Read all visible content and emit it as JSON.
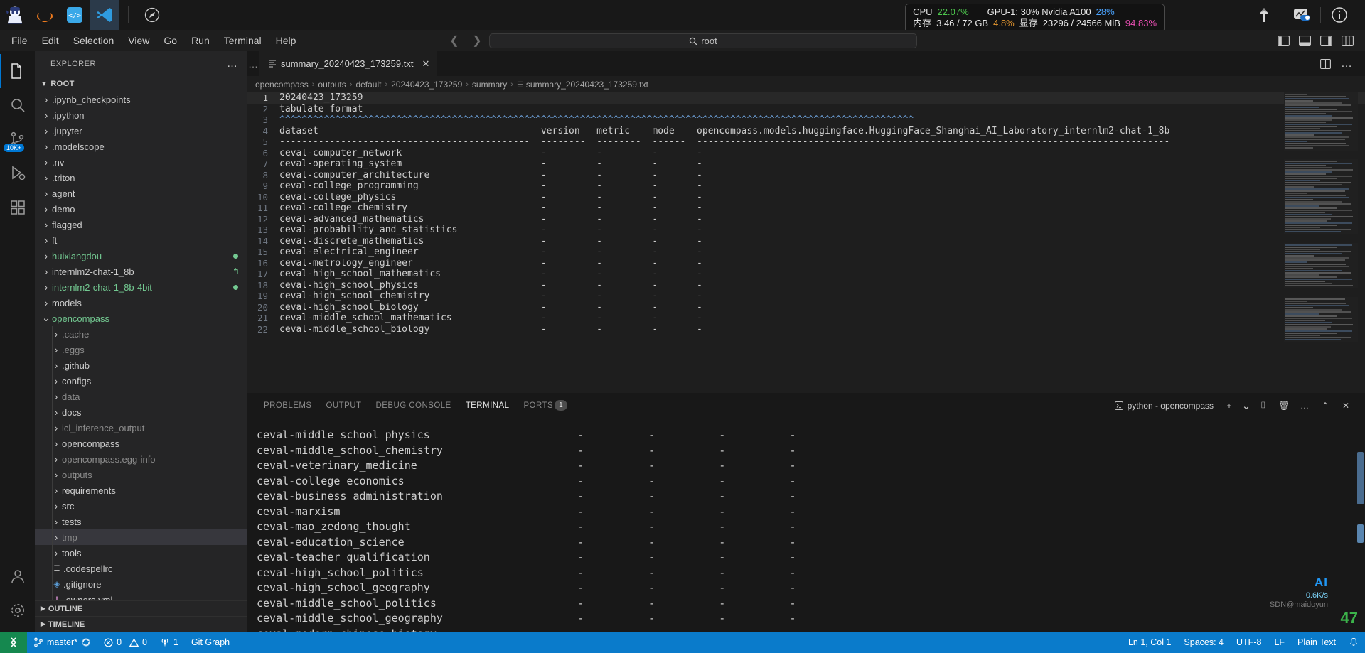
{
  "window": {
    "app_icons": [
      "penguin-app-icon",
      "moon-app-icon",
      "code-server-icon",
      "vscode-icon",
      "compass-icon"
    ]
  },
  "system_monitor": {
    "cpu_label": "CPU",
    "cpu_value": "22.07%",
    "gpu_label": "GPU-1: 30% Nvidia A100",
    "gpu_value": "28%",
    "mem_label": "内存",
    "mem_value": "3.46 / 72 GB",
    "mem_pct": "4.8%",
    "vram_label": "显存",
    "vram_value": "23296 / 24566 MiB",
    "vram_pct": "94.83%"
  },
  "menubar": {
    "items": [
      "File",
      "Edit",
      "Selection",
      "View",
      "Go",
      "Run",
      "Terminal",
      "Help"
    ]
  },
  "command_center": {
    "icon": "search-icon",
    "value": "root"
  },
  "activity_bar": {
    "items": [
      {
        "name": "explorer",
        "icon": "files-icon",
        "badge": ""
      },
      {
        "name": "search",
        "icon": "search-icon",
        "badge": ""
      },
      {
        "name": "source-control",
        "icon": "source-control-icon",
        "badge": "10K+"
      },
      {
        "name": "run-debug",
        "icon": "run-debug-icon",
        "badge": ""
      },
      {
        "name": "extensions",
        "icon": "extensions-icon",
        "badge": ""
      }
    ],
    "bottom_items": [
      {
        "name": "accounts",
        "icon": "account-icon"
      },
      {
        "name": "manage",
        "icon": "gear-icon"
      }
    ]
  },
  "sidebar": {
    "title": "EXPLORER",
    "more_actions": "…",
    "root_label": "ROOT",
    "items": [
      {
        "label": ".ipynb_checkpoints",
        "type": "folder",
        "indent": 1,
        "state": "collapsed",
        "style": "normal",
        "badge": ""
      },
      {
        "label": ".ipython",
        "type": "folder",
        "indent": 1,
        "state": "collapsed",
        "style": "normal",
        "badge": ""
      },
      {
        "label": ".jupyter",
        "type": "folder",
        "indent": 1,
        "state": "collapsed",
        "style": "normal",
        "badge": ""
      },
      {
        "label": ".modelscope",
        "type": "folder",
        "indent": 1,
        "state": "collapsed",
        "style": "normal",
        "badge": ""
      },
      {
        "label": ".nv",
        "type": "folder",
        "indent": 1,
        "state": "collapsed",
        "style": "normal",
        "badge": ""
      },
      {
        "label": ".triton",
        "type": "folder",
        "indent": 1,
        "state": "collapsed",
        "style": "normal",
        "badge": ""
      },
      {
        "label": "agent",
        "type": "folder",
        "indent": 1,
        "state": "collapsed",
        "style": "normal",
        "badge": ""
      },
      {
        "label": "demo",
        "type": "folder",
        "indent": 1,
        "state": "collapsed",
        "style": "normal",
        "badge": ""
      },
      {
        "label": "flagged",
        "type": "folder",
        "indent": 1,
        "state": "collapsed",
        "style": "normal",
        "badge": ""
      },
      {
        "label": "ft",
        "type": "folder",
        "indent": 1,
        "state": "collapsed",
        "style": "normal",
        "badge": ""
      },
      {
        "label": "huixiangdou",
        "type": "folder",
        "indent": 1,
        "state": "collapsed",
        "style": "modified",
        "badge": "dot"
      },
      {
        "label": "internlm2-chat-1_8b",
        "type": "folder",
        "indent": 1,
        "state": "collapsed",
        "style": "normal",
        "badge": "link"
      },
      {
        "label": "internlm2-chat-1_8b-4bit",
        "type": "folder",
        "indent": 1,
        "state": "collapsed",
        "style": "modified",
        "badge": "dot"
      },
      {
        "label": "models",
        "type": "folder",
        "indent": 1,
        "state": "collapsed",
        "style": "normal",
        "badge": ""
      },
      {
        "label": "opencompass",
        "type": "folder",
        "indent": 1,
        "state": "expanded",
        "style": "modified",
        "badge": ""
      },
      {
        "label": ".cache",
        "type": "folder",
        "indent": 2,
        "state": "collapsed",
        "style": "dim",
        "badge": ""
      },
      {
        "label": ".eggs",
        "type": "folder",
        "indent": 2,
        "state": "collapsed",
        "style": "dim",
        "badge": ""
      },
      {
        "label": ".github",
        "type": "folder",
        "indent": 2,
        "state": "collapsed",
        "style": "normal",
        "badge": ""
      },
      {
        "label": "configs",
        "type": "folder",
        "indent": 2,
        "state": "collapsed",
        "style": "normal",
        "badge": ""
      },
      {
        "label": "data",
        "type": "folder",
        "indent": 2,
        "state": "collapsed",
        "style": "dim",
        "badge": ""
      },
      {
        "label": "docs",
        "type": "folder",
        "indent": 2,
        "state": "collapsed",
        "style": "normal",
        "badge": ""
      },
      {
        "label": "icl_inference_output",
        "type": "folder",
        "indent": 2,
        "state": "collapsed",
        "style": "dim",
        "badge": ""
      },
      {
        "label": "opencompass",
        "type": "folder",
        "indent": 2,
        "state": "collapsed",
        "style": "normal",
        "badge": ""
      },
      {
        "label": "opencompass.egg-info",
        "type": "folder",
        "indent": 2,
        "state": "collapsed",
        "style": "dim",
        "badge": ""
      },
      {
        "label": "outputs",
        "type": "folder",
        "indent": 2,
        "state": "collapsed",
        "style": "dim",
        "badge": ""
      },
      {
        "label": "requirements",
        "type": "folder",
        "indent": 2,
        "state": "collapsed",
        "style": "normal",
        "badge": ""
      },
      {
        "label": "src",
        "type": "folder",
        "indent": 2,
        "state": "collapsed",
        "style": "normal",
        "badge": ""
      },
      {
        "label": "tests",
        "type": "folder",
        "indent": 2,
        "state": "collapsed",
        "style": "normal",
        "badge": ""
      },
      {
        "label": "tmp",
        "type": "folder",
        "indent": 2,
        "state": "collapsed",
        "style": "dim",
        "badge": "",
        "selected": true
      },
      {
        "label": "tools",
        "type": "folder",
        "indent": 2,
        "state": "collapsed",
        "style": "normal",
        "badge": ""
      },
      {
        "label": ".codespellrc",
        "type": "file",
        "indent": 2,
        "state": "",
        "style": "normal",
        "badge": "",
        "fileicon": "text-file-icon"
      },
      {
        "label": ".gitignore",
        "type": "file",
        "indent": 2,
        "state": "",
        "style": "normal",
        "badge": "",
        "fileicon": "git-file-icon"
      },
      {
        "label": ".owners.yml",
        "type": "file",
        "indent": 2,
        "state": "",
        "style": "normal",
        "badge": "",
        "fileicon": "yaml-file-icon"
      }
    ],
    "outline_label": "OUTLINE",
    "timeline_label": "TIMELINE"
  },
  "editor": {
    "tab": {
      "icon": "text-file-icon",
      "label": "summary_20240423_173259.txt",
      "close": "✕"
    },
    "tab_actions": [
      "split-editor-icon",
      "more-actions-icon"
    ],
    "breadcrumb": [
      "opencompass",
      "outputs",
      "default",
      "20240423_173259",
      "summary",
      "summary_20240423_173259.txt"
    ],
    "lines": [
      {
        "n": 1,
        "text": "20240423_173259"
      },
      {
        "n": 2,
        "text": "tabulate format"
      },
      {
        "n": 3,
        "text": "^^^^^^^^^^^^^^^^^^^^^^^^^^^^^^^^^^^^^^^^^^^^^^^^^^^^^^^^^^^^^^^^^^^^^^^^^^^^^^^^^^^^^^^^^^^^^^^^^^^^^^^^^^^^^^^^^^"
      },
      {
        "n": 4,
        "text": "dataset                                        version   metric    mode    opencompass.models.huggingface.HuggingFace_Shanghai_AI_Laboratory_internlm2-chat-1_8b"
      },
      {
        "n": 5,
        "text": "---------------------------------------------  --------  --------  ------  -------------------------------------------------------------------------------------"
      },
      {
        "n": 6,
        "text": "ceval-computer_network                         -         -         -       -"
      },
      {
        "n": 7,
        "text": "ceval-operating_system                         -         -         -       -"
      },
      {
        "n": 8,
        "text": "ceval-computer_architecture                    -         -         -       -"
      },
      {
        "n": 9,
        "text": "ceval-college_programming                      -         -         -       -"
      },
      {
        "n": 10,
        "text": "ceval-college_physics                          -         -         -       -"
      },
      {
        "n": 11,
        "text": "ceval-college_chemistry                        -         -         -       -"
      },
      {
        "n": 12,
        "text": "ceval-advanced_mathematics                     -         -         -       -"
      },
      {
        "n": 13,
        "text": "ceval-probability_and_statistics               -         -         -       -"
      },
      {
        "n": 14,
        "text": "ceval-discrete_mathematics                     -         -         -       -"
      },
      {
        "n": 15,
        "text": "ceval-electrical_engineer                      -         -         -       -"
      },
      {
        "n": 16,
        "text": "ceval-metrology_engineer                       -         -         -       -"
      },
      {
        "n": 17,
        "text": "ceval-high_school_mathematics                  -         -         -       -"
      },
      {
        "n": 18,
        "text": "ceval-high_school_physics                      -         -         -       -"
      },
      {
        "n": 19,
        "text": "ceval-high_school_chemistry                    -         -         -       -"
      },
      {
        "n": 20,
        "text": "ceval-high_school_biology                      -         -         -       -"
      },
      {
        "n": 21,
        "text": "ceval-middle_school_mathematics                -         -         -       -"
      },
      {
        "n": 22,
        "text": "ceval-middle_school_biology                    -         -         -       -"
      }
    ]
  },
  "panel": {
    "tabs": [
      {
        "label": "PROBLEMS",
        "active": false,
        "badge": ""
      },
      {
        "label": "OUTPUT",
        "active": false,
        "badge": ""
      },
      {
        "label": "DEBUG CONSOLE",
        "active": false,
        "badge": ""
      },
      {
        "label": "TERMINAL",
        "active": true,
        "badge": ""
      },
      {
        "label": "PORTS",
        "active": false,
        "badge": "1"
      }
    ],
    "terminal_name": "python - opencompass",
    "actions": [
      "new-terminal-icon",
      "chevron-down-icon",
      "split-terminal-icon",
      "kill-terminal-icon",
      "more-actions-icon",
      "maximize-panel-icon",
      "close-panel-icon"
    ],
    "terminal_lines": [
      "ceval-middle_school_physics                       -          -          -          -",
      "ceval-middle_school_chemistry                     -          -          -          -",
      "ceval-veterinary_medicine                         -          -          -          -",
      "ceval-college_economics                           -          -          -          -",
      "ceval-business_administration                     -          -          -          -",
      "ceval-marxism                                     -          -          -          -",
      "ceval-mao_zedong_thought                          -          -          -          -",
      "ceval-education_science                           -          -          -          -",
      "ceval-teacher_qualification                       -          -          -          -",
      "ceval-high_school_politics                        -          -          -          -",
      "ceval-high_school_geography                       -          -          -          -",
      "ceval-middle_school_politics                      -          -          -          -",
      "ceval-middle_school_geography                     -          -          -          -",
      "ceval-modern_chinese_history                      -          -          -          -"
    ]
  },
  "overlay": {
    "ai_label": "AI",
    "net_rate": "0.6K/s",
    "ip_text": "SDN@maidoyun",
    "net_value": "47"
  },
  "statusbar": {
    "remote_icon": "remote-window-icon",
    "branch": "master*",
    "sync_icon": "sync-icon",
    "errors": "0",
    "warnings": "0",
    "radio_count": "1",
    "git_graph": "Git Graph",
    "cursor_position": "Ln 1, Col 1",
    "spaces": "Spaces: 4",
    "encoding": "UTF-8",
    "eol": "LF",
    "language": "Plain Text",
    "bell_icon": "bell-icon"
  }
}
